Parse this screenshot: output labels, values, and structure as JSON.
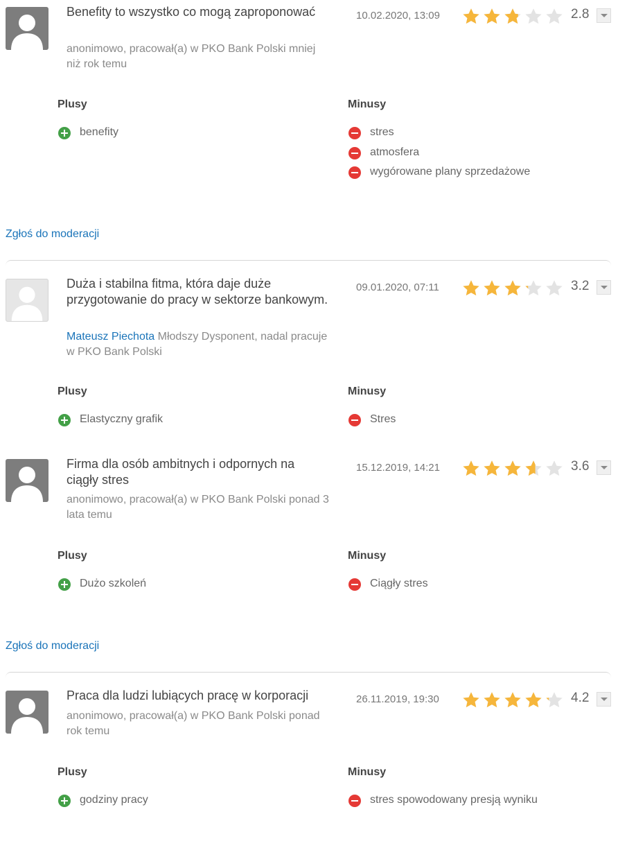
{
  "colors": {
    "link": "#1a74b9",
    "star": "#f6b63b",
    "plus": "#43a047",
    "minus": "#e53935"
  },
  "labels": {
    "pros": "Plusy",
    "cons": "Minusy",
    "report": "Zgłoś do moderacji"
  },
  "reviews": [
    {
      "title": "Benefity to wszystko co mogą zaproponować",
      "author_name": "",
      "author_text": "anonimowo, pracował(a) w PKO Bank Polski mniej niż rok temu",
      "date": "10.02.2020, 13:09",
      "rating": 2.8,
      "rating_text": "2.8",
      "avatar": "user-silhouette-dark",
      "pros": [
        "benefity"
      ],
      "cons": [
        "stres",
        "atmosfera",
        "wygórowane plany sprzedażowe"
      ]
    },
    {
      "title": "Duża i stabilna fitma, która daje duże przygotowanie do pracy w sektorze bankowym.",
      "author_name": "Mateusz Piechota",
      "author_text": " Młodszy Dysponent, nadal pracuje w PKO Bank Polski",
      "date": "09.01.2020, 07:11",
      "rating": 3.2,
      "rating_text": "3.2",
      "avatar": "user-silhouette-light",
      "pros": [
        "Elastyczny grafik"
      ],
      "cons": [
        "Stres"
      ]
    },
    {
      "title": "Firma dla osób ambitnych i odpornych na ciągły stres",
      "author_name": "",
      "author_text": "anonimowo, pracował(a) w PKO Bank Polski ponad 3 lata temu",
      "date": "15.12.2019, 14:21",
      "rating": 3.6,
      "rating_text": "3.6",
      "avatar": "user-silhouette-dark",
      "pros": [
        "Dużo szkoleń"
      ],
      "cons": [
        "Ciągły stres"
      ]
    },
    {
      "title": "Praca dla ludzi lubiących pracę w korporacji",
      "author_name": "",
      "author_text": "anonimowo, pracował(a) w PKO Bank Polski ponad rok temu",
      "date": "26.11.2019, 19:30",
      "rating": 4.2,
      "rating_text": "4.2",
      "avatar": "user-silhouette-dark",
      "pros": [
        "godziny pracy"
      ],
      "cons": [
        "stres spowodowany presją wyniku"
      ]
    }
  ]
}
